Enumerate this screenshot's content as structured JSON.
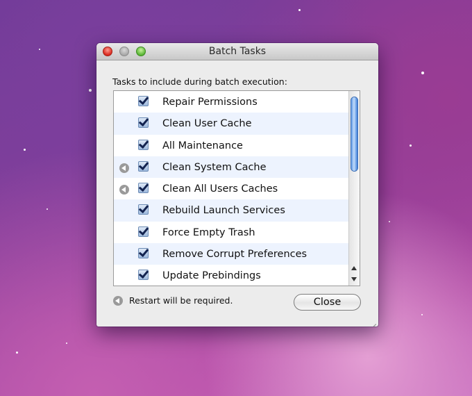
{
  "window": {
    "title": "Batch Tasks"
  },
  "intro_text": "Tasks to include during batch execution:",
  "tasks": [
    {
      "label": "Repair Permissions",
      "checked": true,
      "restart_required": false
    },
    {
      "label": "Clean User Cache",
      "checked": true,
      "restart_required": false
    },
    {
      "label": "All Maintenance",
      "checked": true,
      "restart_required": false
    },
    {
      "label": "Clean System Cache",
      "checked": true,
      "restart_required": true
    },
    {
      "label": "Clean All Users Caches",
      "checked": true,
      "restart_required": true
    },
    {
      "label": "Rebuild Launch Services",
      "checked": true,
      "restart_required": false
    },
    {
      "label": "Force Empty Trash",
      "checked": true,
      "restart_required": false
    },
    {
      "label": "Remove Corrupt Preferences",
      "checked": true,
      "restart_required": false
    },
    {
      "label": "Update Prebindings",
      "checked": true,
      "restart_required": false
    }
  ],
  "notice_text": "Restart will be required.",
  "buttons": {
    "close_label": "Close"
  },
  "icons": {
    "restart": "restart-indicator-icon",
    "checkbox": "checkmark-icon"
  },
  "colors": {
    "row_alt": "#edf3fe",
    "scroll_thumb": "#5f9ae6",
    "checkbox_fill": "#9db8dc"
  }
}
